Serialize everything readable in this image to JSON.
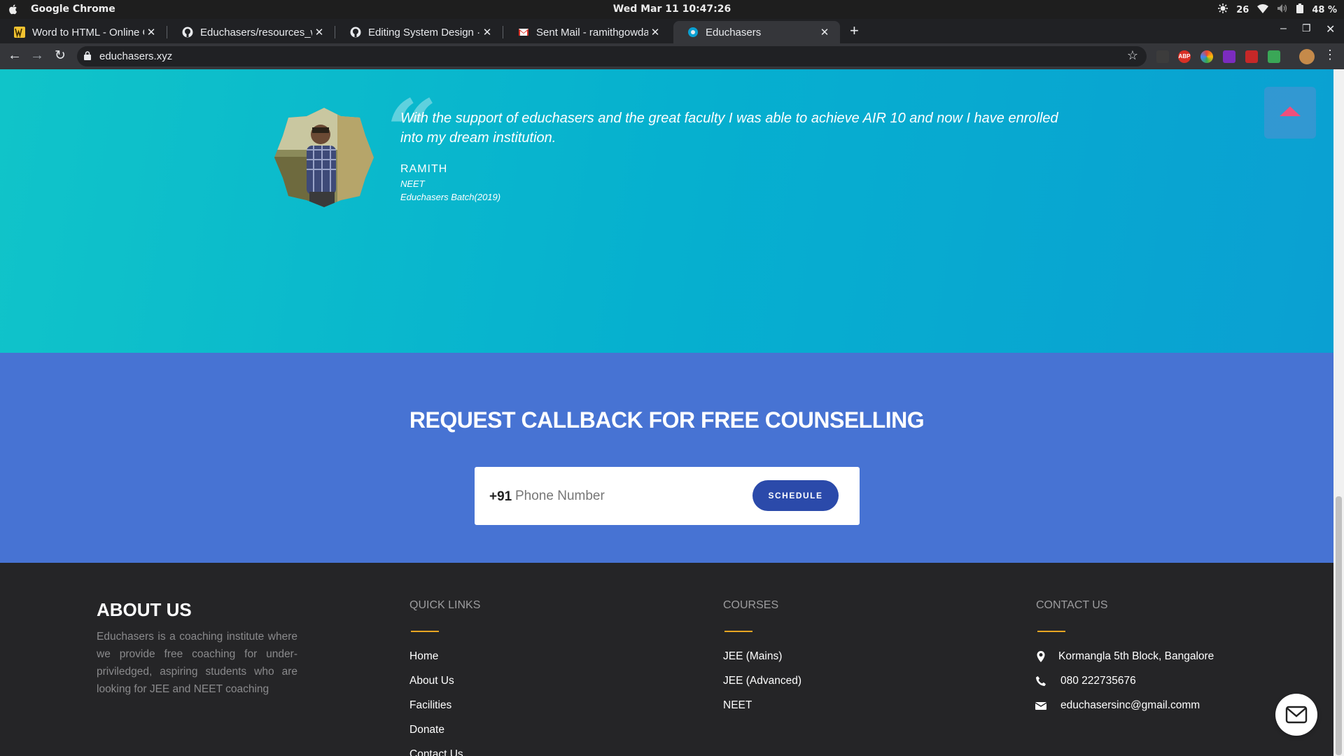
{
  "system_bar": {
    "app_name": "Google Chrome",
    "clock": "Wed Mar 11  10:47:26",
    "brightness_value": "26",
    "battery": "48 %"
  },
  "browser": {
    "tabs": [
      {
        "title": "Word to HTML - Online Co",
        "icon": "wordtohtml-favicon"
      },
      {
        "title": "Educhasers/resources_wi",
        "icon": "github-icon"
      },
      {
        "title": "Editing System Design · ra",
        "icon": "github-icon"
      },
      {
        "title": "Sent Mail - ramithgowdak",
        "icon": "gmail-icon"
      },
      {
        "title": "Educhasers",
        "icon": "educhasers-favicon",
        "active": true
      }
    ],
    "url": "educhasers.xyz"
  },
  "testimonial": {
    "quote": "With the support of educhasers and the great faculty I was able to achieve AIR 10 and now I have enrolled into my dream institution.",
    "name": "RAMITH",
    "course": "NEET",
    "batch": "Educhasers Batch(2019)"
  },
  "callback": {
    "title": "REQUEST CALLBACK FOR FREE COUNSELLING",
    "country_code": "+91",
    "phone_placeholder": "Phone Number",
    "button_label": "SCHEDULE"
  },
  "footer": {
    "about": {
      "title": "ABOUT US",
      "text": "Educhasers is a coaching institute where we provide free coaching for under-priviledged, aspiring students who are looking for JEE and NEET coaching"
    },
    "quick_links": {
      "title": "QUICK LINKS",
      "items": [
        "Home",
        "About Us",
        "Facilities",
        "Donate",
        "Contact Us"
      ]
    },
    "courses": {
      "title": "COURSES",
      "items": [
        "JEE (Mains)",
        "JEE (Advanced)",
        "NEET"
      ]
    },
    "contact": {
      "title": "CONTACT US",
      "address": "Kormangla 5th Block, Bangalore",
      "phone": "080 222735676",
      "email": "educhasersinc@gmail.comm"
    }
  },
  "colors": {
    "testimonial_bg": "#06b0cf",
    "callback_bg": "#4773d3",
    "footer_bg": "#252527",
    "accent_line": "#e8a622",
    "schedule_button": "#2b4aaa",
    "scroll_top_arrow": "#f04f7c"
  }
}
